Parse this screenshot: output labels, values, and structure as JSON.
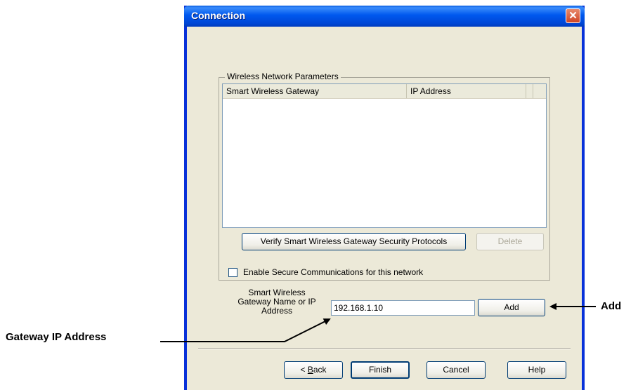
{
  "dialog": {
    "title": "Connection",
    "close_icon": "close-icon"
  },
  "group": {
    "legend": "Wireless Network Parameters",
    "columns": [
      "Smart Wireless Gateway",
      "IP Address"
    ],
    "rows": []
  },
  "buttons": {
    "verify": "Verify Smart Wireless Gateway Security Protocols",
    "delete": "Delete",
    "add": "Add",
    "back_prefix": "< ",
    "back_mnemonic": "B",
    "back_rest": "ack",
    "finish": "Finish",
    "cancel": "Cancel",
    "help": "Help"
  },
  "secure": {
    "label": "Enable Secure Communications for this network",
    "checked": false
  },
  "gateway_field": {
    "label_line1": "Smart Wireless",
    "label_line2": "Gateway Name or IP",
    "label_line3": "Address",
    "value": "192.168.1.10"
  },
  "annotations": {
    "add": "Add",
    "gateway_ip": "Gateway IP Address"
  }
}
